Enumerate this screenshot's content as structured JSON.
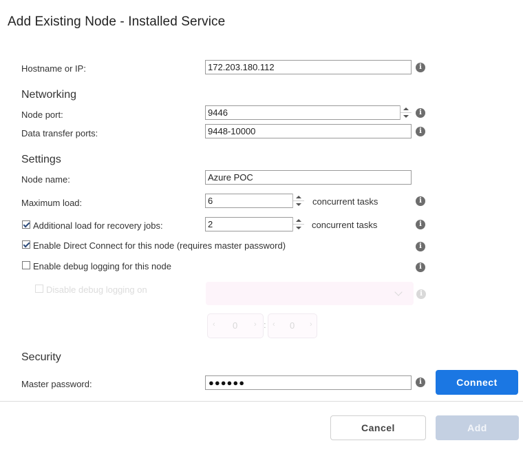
{
  "dialog": {
    "title": "Add Existing Node - Installed Service"
  },
  "hostname": {
    "label": "Hostname or IP:",
    "value": "172.203.180.112"
  },
  "networking": {
    "heading": "Networking",
    "node_port_label": "Node port:",
    "node_port_value": "9446",
    "data_ports_label": "Data transfer ports:",
    "data_ports_value": "9448-10000"
  },
  "settings": {
    "heading": "Settings",
    "node_name_label": "Node name:",
    "node_name_value": "Azure POC",
    "max_load_label": "Maximum load:",
    "max_load_value": "6",
    "max_load_unit": "concurrent tasks",
    "recovery_label": "Additional load for recovery jobs:",
    "recovery_checked": true,
    "recovery_value": "2",
    "recovery_unit": "concurrent tasks",
    "direct_connect_label": "Enable Direct Connect for this node (requires master password)",
    "direct_connect_checked": true,
    "debug_label": "Enable debug logging for this node",
    "debug_checked": false,
    "disable_debug_label": "Disable debug logging on",
    "disable_debug_hours": "0",
    "disable_debug_minutes": "0"
  },
  "security": {
    "heading": "Security",
    "password_label": "Master password:",
    "password_value": "●●●●●●",
    "connect_label": "Connect"
  },
  "footer": {
    "cancel_label": "Cancel",
    "add_label": "Add"
  },
  "icons": {
    "info": "i"
  },
  "colors": {
    "primary": "#1b77e3",
    "disabled": "#c4d0e2"
  }
}
